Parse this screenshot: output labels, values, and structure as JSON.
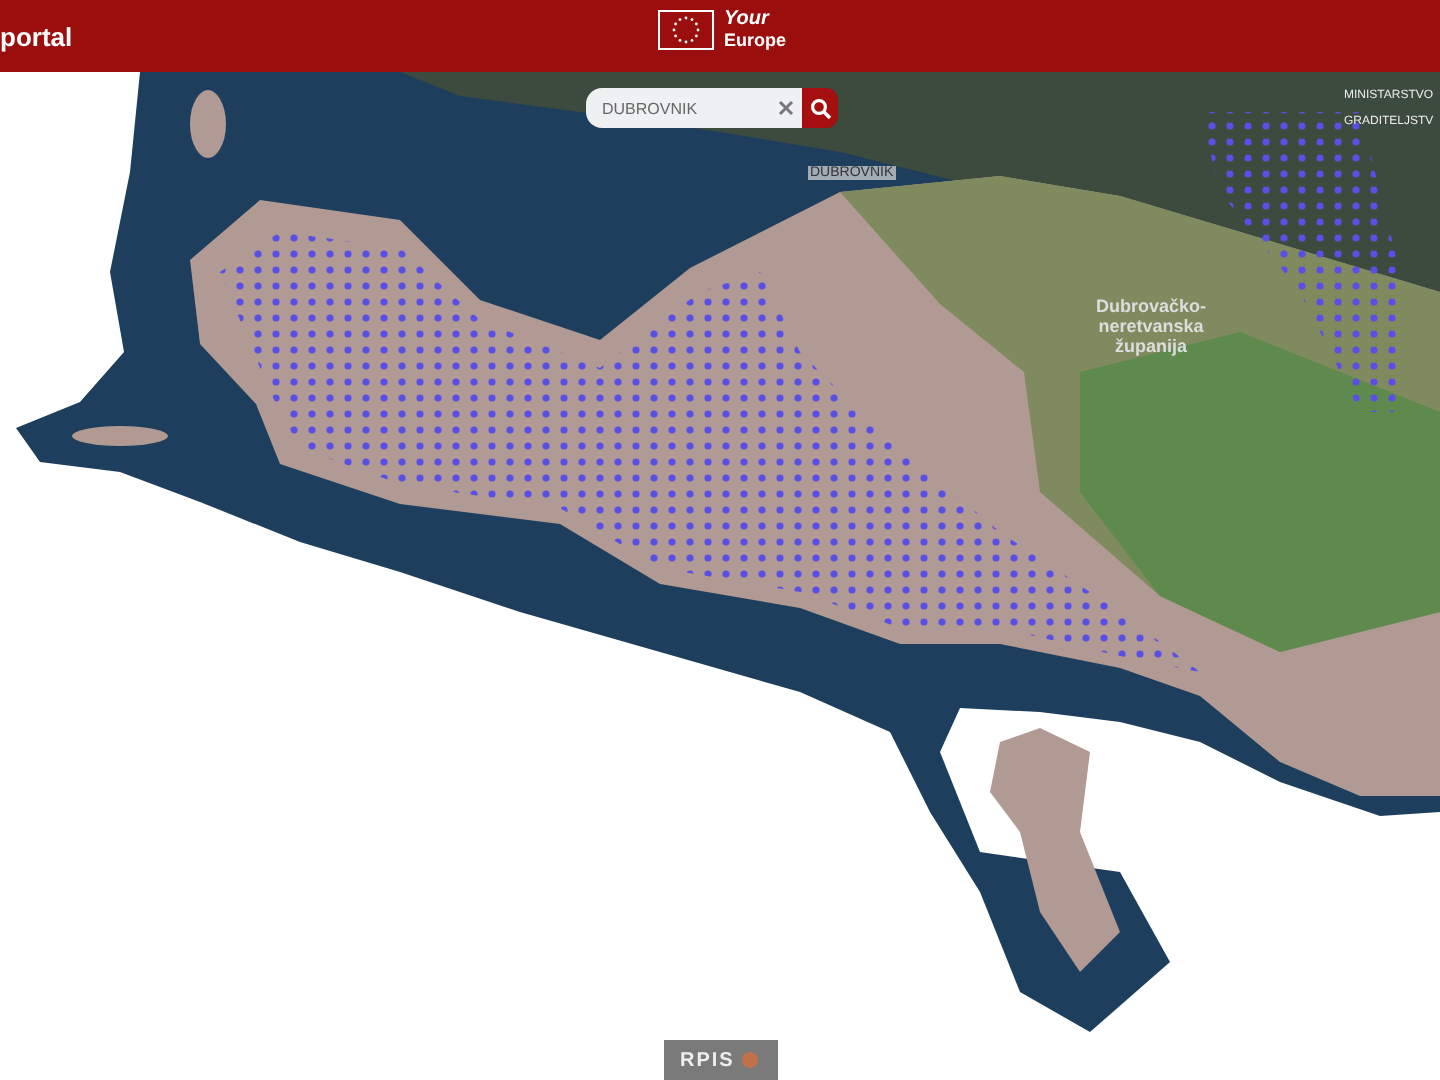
{
  "header": {
    "title": "portal",
    "logo": {
      "line_1": "Your",
      "line_2": "Europe"
    }
  },
  "search": {
    "value": "DUBROVNIK"
  },
  "map": {
    "labels": [
      {
        "kind": "place",
        "lines": [
          "DUBROVNIK"
        ]
      },
      {
        "kind": "region",
        "lines": [
          "Dubrovačko-",
          "neretvanska",
          "županija"
        ]
      },
      {
        "kind": "institution",
        "lines": [
          "MINISTARSTVO",
          "GRADITELJSTV"
        ]
      }
    ]
  },
  "footer_logo": "RPIS"
}
